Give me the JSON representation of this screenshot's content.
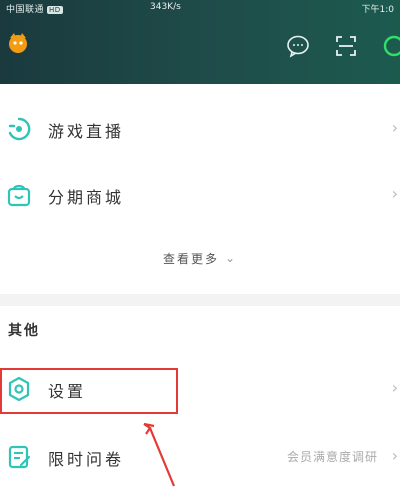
{
  "status_bar": {
    "carrier": "中国联通",
    "badge": "HD",
    "center_text": "343K/s",
    "right_text": "下午1:0"
  },
  "header": {
    "avatar_icon": "app-mascot-icon",
    "icons": [
      "chat-bubble-icon",
      "scan-icon",
      "app-icon"
    ]
  },
  "list_top": [
    {
      "label": "游戏直播",
      "icon": "game-live-icon"
    },
    {
      "label": "分期商城",
      "icon": "shopping-bag-icon"
    }
  ],
  "see_more": "查看更多",
  "section": {
    "title": "其他"
  },
  "list_other": [
    {
      "label": "设置",
      "icon": "settings-icon",
      "extra": ""
    },
    {
      "label": "限时问卷",
      "icon": "survey-icon",
      "extra": "会员满意度调研"
    }
  ],
  "colors": {
    "header_bg": "#1f4d4a",
    "accent": "#2ec4b6",
    "highlight": "#e53935"
  }
}
